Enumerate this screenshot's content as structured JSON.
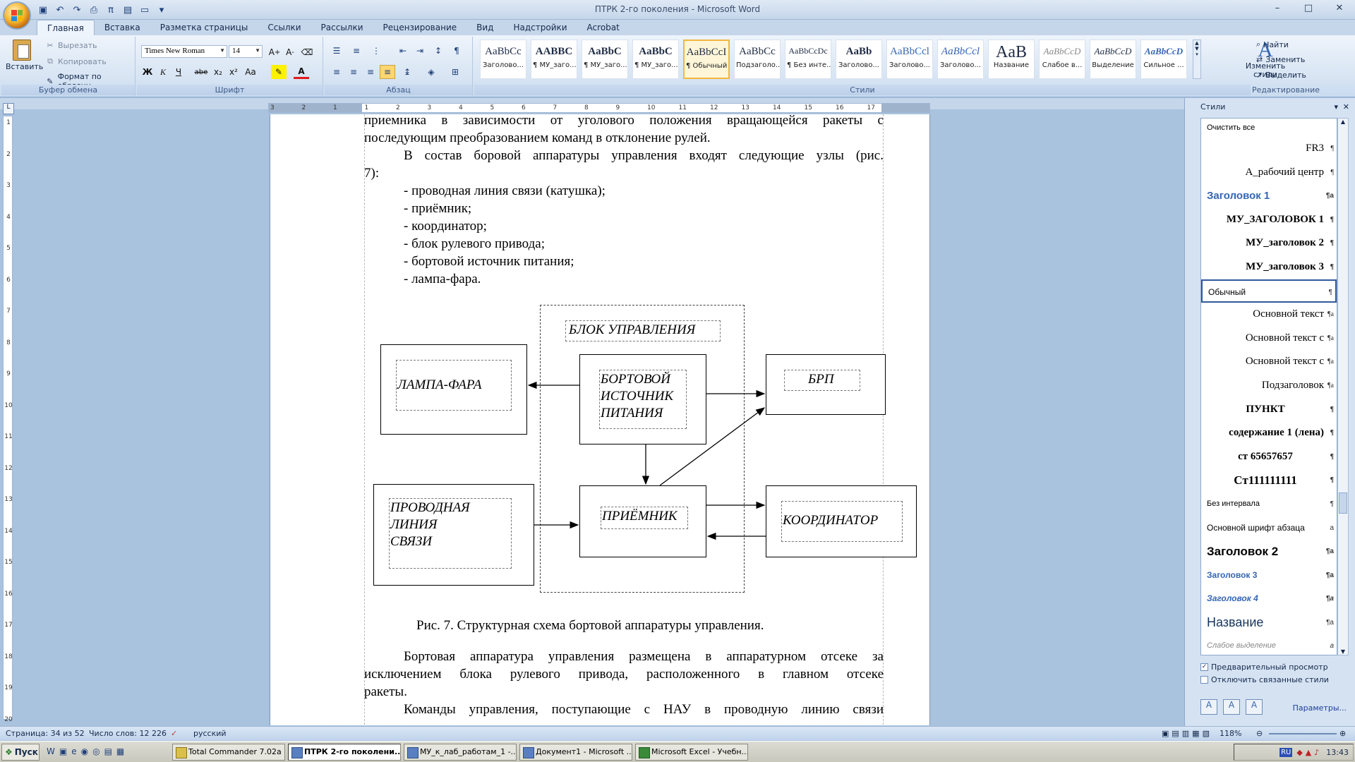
{
  "window": {
    "title": "ПТРК  2-го поколения - Microsoft Word",
    "controls": [
      "–",
      "□",
      "✕"
    ]
  },
  "tabs": [
    "Главная",
    "Вставка",
    "Разметка страницы",
    "Ссылки",
    "Рассылки",
    "Рецензирование",
    "Вид",
    "Надстройки",
    "Acrobat"
  ],
  "ribbon": {
    "clipboard": {
      "paste": "Вставить",
      "cut": "Вырезать",
      "copy": "Копировать",
      "format_painter": "Формат по образцу",
      "label": "Буфер обмена"
    },
    "font": {
      "name": "Times New Roman",
      "size": "14",
      "label": "Шрифт",
      "buttons": [
        "Ж",
        "К",
        "Ч",
        "abe",
        "x₂",
        "x²",
        "Aa"
      ]
    },
    "paragraph": {
      "label": "Абзац"
    },
    "styles": {
      "label": "Стили",
      "tiles": [
        {
          "sample": "AaBbCc",
          "name": "Заголово..."
        },
        {
          "sample": "AABBC",
          "name": "¶ МУ_заго..."
        },
        {
          "sample": "AaBbC",
          "name": "¶ МУ_заго..."
        },
        {
          "sample": "AaBbC",
          "name": "¶ МУ_заго..."
        },
        {
          "sample": "AaBbCcI",
          "name": "¶ Обычный"
        },
        {
          "sample": "AaBbCc",
          "name": "Подзаголо..."
        },
        {
          "sample": "AaBbCcDc",
          "name": "¶ Без инте..."
        },
        {
          "sample": "AaBb",
          "name": "Заголово..."
        },
        {
          "sample": "AaBbCcl",
          "name": "Заголово..."
        },
        {
          "sample": "AaBbCcl",
          "name": "Заголово..."
        },
        {
          "sample": "AaB",
          "name": "Название"
        },
        {
          "sample": "AaBbCcD",
          "name": "Слабое в..."
        },
        {
          "sample": "AaBbCcD",
          "name": "Выделение"
        },
        {
          "sample": "AaBbCcD",
          "name": "Сильное ..."
        }
      ],
      "change_styles": "Изменить стили"
    },
    "editing": {
      "label": "Редактирование",
      "find": "Найти",
      "replace": "Заменить",
      "select": "Выделить"
    }
  },
  "ruler": {
    "h_ticks": [
      "3",
      "2",
      "1",
      "1",
      "2",
      "3",
      "4",
      "5",
      "6",
      "7",
      "8",
      "9",
      "10",
      "11",
      "12",
      "13",
      "14",
      "15",
      "16",
      "17"
    ],
    "v_ticks": [
      "1",
      "2",
      "3",
      "4",
      "5",
      "6",
      "7",
      "8",
      "9",
      "10",
      "11",
      "12",
      "13",
      "14",
      "15",
      "16",
      "17",
      "18",
      "19",
      "20"
    ]
  },
  "document": {
    "line1": "приемника в зависимости от уголового положения вращающейся ракеты с",
    "line2": "последующим преобразованием команд в отклонение рулей.",
    "line3": "В состав боровой аппаратуры управления входят следующие узлы (рис.",
    "line4": "7):",
    "list": [
      "- проводная линия связи (катушка);",
      "- приёмник;",
      "- координатор;",
      "- блок рулевого привода;",
      "- бортовой источник питания;",
      "- лампа-фара."
    ],
    "caption": "Рис. 7. Структурная схема бортовой аппаратуры управления.",
    "para2_line1": "Бортовая аппаратура управления размещена в аппаратурном отсеке за",
    "para2_line2": "исключением блока рулевого привода, расположенного в главном отсеке",
    "para2_line3": "ракеты.",
    "para3_line1": "Команды управления, поступающие с НАУ в проводную линию связи"
  },
  "diagram": {
    "block_title": "БЛОК УПРАВЛЕНИЯ",
    "lamp": "ЛАМПА-ФАРА",
    "power": "БОРТОВОЙ\nИСТОЧНИК\nПИТАНИЯ",
    "brp": "БРП",
    "wire": "ПРОВОДНАЯ\nЛИНИЯ\nСВЯЗИ",
    "receiver": "ПРИЁМНИК",
    "coordinator": "КООРДИНАТОР"
  },
  "styles_pane": {
    "title": "Стили",
    "items": [
      {
        "name": "Очистить все",
        "mark": ""
      },
      {
        "name": "FR3",
        "mark": "¶"
      },
      {
        "name": "А_рабочий центр",
        "mark": "¶"
      },
      {
        "name": "Заголовок 1",
        "mark": "¶a"
      },
      {
        "name": "МУ_ЗАГОЛОВОК 1",
        "mark": "¶"
      },
      {
        "name": "МУ_заголовок 2",
        "mark": "¶"
      },
      {
        "name": "МУ_заголовок 3",
        "mark": "¶"
      },
      {
        "name": "Обычный",
        "mark": "¶"
      },
      {
        "name": "Основной текст",
        "mark": "¶a"
      },
      {
        "name": "Основной текст с",
        "mark": "¶a"
      },
      {
        "name": "Основной текст с",
        "mark": "¶a"
      },
      {
        "name": "Подзаголовок",
        "mark": "¶a"
      },
      {
        "name": "ПУНКТ",
        "mark": "¶"
      },
      {
        "name": "содержание 1 (лена)",
        "mark": "¶"
      },
      {
        "name": "ст 65657657",
        "mark": "¶"
      },
      {
        "name": "Ст111111111",
        "mark": "¶"
      },
      {
        "name": "Без интервала",
        "mark": "¶"
      },
      {
        "name": "Основной шрифт абзаца",
        "mark": "a"
      },
      {
        "name": "Заголовок 2",
        "mark": "¶a"
      },
      {
        "name": "Заголовок 3",
        "mark": "¶a"
      },
      {
        "name": "Заголовок 4",
        "mark": "¶a"
      },
      {
        "name": "Название",
        "mark": "¶a"
      },
      {
        "name": "Слабое выделение",
        "mark": "a"
      }
    ],
    "preview": "Предварительный просмотр",
    "disable_linked": "Отключить связанные стили",
    "params": "Параметры..."
  },
  "statusbar": {
    "page": "Страница: 34 из 52",
    "words": "Число слов: 12 226",
    "language": "русский",
    "zoom": "118%"
  },
  "taskbar": {
    "start": "Пуск",
    "tasks": [
      "Total Commander 7.02a ...",
      "ПТРК  2-го поколени...",
      "МУ_к_лаб_работам_1 -...",
      "Документ1 - Microsoft ...",
      "Microsoft Excel - Учебн..."
    ],
    "lang": "RU",
    "clock": "13:43"
  },
  "colors": {
    "accent": "#31599c",
    "ribbon_bg": "#d7e4f3",
    "canvas_bg": "#a9c2de",
    "selected_style": "#f2b640"
  }
}
